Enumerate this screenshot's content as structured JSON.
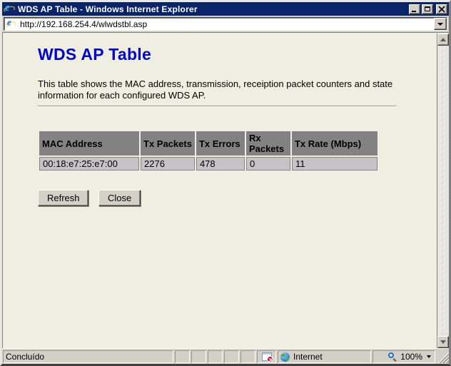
{
  "window": {
    "title": "WDS AP Table - Windows Internet Explorer"
  },
  "address_bar": {
    "url": "http://192.168.254.4/wlwdstbl.asp"
  },
  "page": {
    "heading": "WDS AP Table",
    "description": "This table shows the MAC address, transmission, receiption packet counters and state information for each configured WDS AP.",
    "table": {
      "headers": [
        "MAC Address",
        "Tx Packets",
        "Tx Errors",
        "Rx Packets",
        "Tx Rate (Mbps)"
      ],
      "rows": [
        [
          "00:18:e7:25:e7:00",
          "2276",
          "478",
          "0",
          "11"
        ]
      ]
    },
    "buttons": {
      "refresh": "Refresh",
      "close": "Close"
    }
  },
  "status_bar": {
    "status": "Concluído",
    "zone": "Internet",
    "zoom_level": "100%"
  },
  "icons": {
    "titlebar_left": "internet-explorer-logo",
    "status_left": "protected-mode-off-icon",
    "zone": "globe-icon",
    "zoom": "magnifier-icon"
  },
  "colors": {
    "title_bar": "#0A246A",
    "chrome": "#D4D0C8",
    "page_background": "#EFEFE1",
    "heading": "#0000CC",
    "table_header_bg": "#828282",
    "table_row_bg": "#C6C3C6"
  }
}
